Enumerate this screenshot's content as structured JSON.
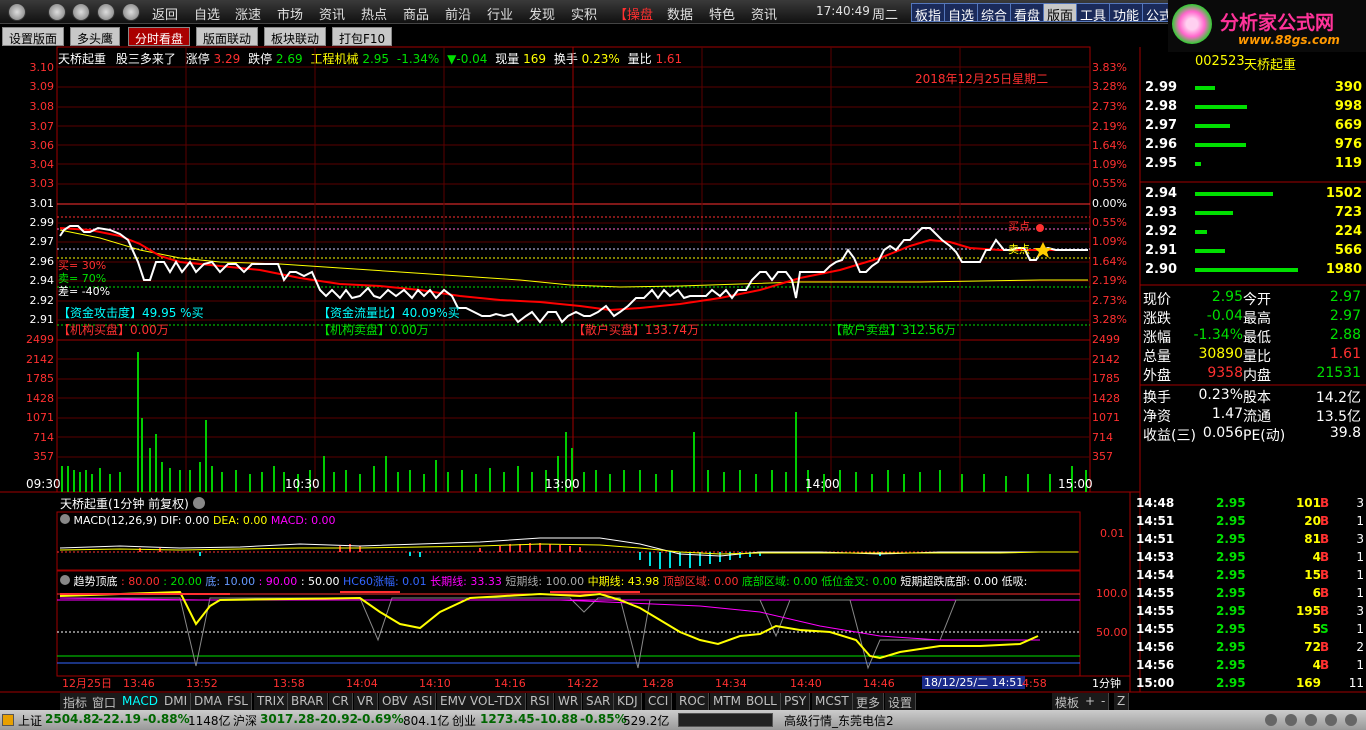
{
  "menu": {
    "items": [
      "返回",
      "自选",
      "涨速",
      "市场",
      "资讯",
      "热点",
      "商品",
      "前沿",
      "行业",
      "发现",
      "实积"
    ],
    "special": "【操盘",
    "items2": [
      "数据",
      "特色",
      "资讯"
    ],
    "time": "17:40:49",
    "weekday": "周二",
    "buttons": [
      "板指",
      "自选",
      "综合",
      "看盘",
      "版面",
      "工具",
      "功能",
      "公式"
    ]
  },
  "logo": {
    "line1": "分析家公式网",
    "line2": "www.88gs.com"
  },
  "tabs": [
    "设置版面",
    "多头鹰",
    "分时看盘",
    "版面联动",
    "板块联动",
    "打包F10"
  ],
  "header": {
    "name": "天桥起重",
    "tag": "股三多来了",
    "zt_label": "涨停",
    "zt": "3.29",
    "dt_label": "跌停",
    "dt": "2.69",
    "sector": "工程机械",
    "price": "2.95",
    "pct": "-1.34%",
    "chg": "▼-0.04",
    "xl_label": "现量",
    "xl": "169",
    "hs_label": "换手",
    "hs": "0.23%",
    "lb_label": "量比",
    "lb": "1.61",
    "date": "2018年12月25日星期二"
  },
  "price_axis": {
    "left": [
      "3.10",
      "3.09",
      "3.08",
      "3.07",
      "3.06",
      "3.04",
      "3.03",
      "3.01",
      "2.99",
      "2.97",
      "2.96",
      "2.94",
      "2.92",
      "2.91",
      "2.89"
    ],
    "right": [
      "3.83%",
      "3.28%",
      "2.73%",
      "2.19%",
      "1.64%",
      "1.09%",
      "0.55%",
      "0.00%",
      "0.55%",
      "1.09%",
      "1.64%",
      "2.19%",
      "2.73%",
      "3.28%"
    ]
  },
  "vol_axis": [
    "2499",
    "2142",
    "1785",
    "1428",
    "1071",
    "714",
    "357"
  ],
  "time_axis": [
    "09:30",
    "10:30",
    "13:00",
    "14:00",
    "15:00"
  ],
  "overlay": {
    "buy": "买= 30%",
    "sell": "卖= 70%",
    "diff": "差= -40%",
    "attack": "【资金攻击度】49.95 %买",
    "flow": "【资金流量比】40.09%买",
    "org_buy": "【机构买盘】0.00万",
    "org_sell": "【机构卖盘】0.00万",
    "retail_buy": "【散户买盘】133.74万",
    "retail_sell": "【散户卖盘】312.56万",
    "buy_pt": "买点",
    "sell_pt": "卖点"
  },
  "sub_title": "天桥起重(1分钟 前复权)",
  "macd": {
    "label": "MACD(12,26,9)",
    "dif": "DIF: 0.00",
    "dea": "DEA: 0.00",
    "macd": "MACD: 0.00",
    "axis": "0.01"
  },
  "trend": {
    "label": "趋势顶底",
    "v1": ": 80.00",
    "v2": ": 20.00",
    "v3": "底: 10.00",
    "v4": ": 90.00",
    "v5": ": 50.00",
    "hc": "HC60涨幅: 0.01",
    "lq": "长期线: 33.33",
    "sq": "短期线: 100.00",
    "mq": "中期线: 43.98",
    "top": "顶部区域: 0.00",
    "bot": "底部区域: 0.00",
    "gold": "低位金叉: 0.00",
    "over": "短期超跌底部: 0.00",
    "low": "低吸:",
    "axis": [
      "100.0",
      "50.00"
    ]
  },
  "sub_time": [
    "12月25日",
    "13:46",
    "13:52",
    "13:58",
    "14:04",
    "14:10",
    "14:16",
    "14:22",
    "14:28",
    "14:34",
    "14:40",
    "14:46",
    "14:52"
  ],
  "sub_cursor": "18/12/25/二 14:51",
  "sub_period": "1分钟",
  "sub_end": "4:58",
  "indicators": [
    "指标",
    "窗口",
    "MACD",
    "DMI",
    "DMA",
    "FSL",
    "TRIX",
    "BRAR",
    "CR",
    "VR",
    "OBV",
    "ASI",
    "EMV",
    "VOL-TDX",
    "RSI",
    "WR",
    "SAR",
    "KDJ",
    "CCI",
    "ROC",
    "MTM",
    "BOLL",
    "PSY",
    "MCST",
    "更多",
    "设置"
  ],
  "right_btns": [
    "模板",
    "+",
    "-",
    "Z"
  ],
  "stock": {
    "code": "002523",
    "name": "天桥起重"
  },
  "asks": [
    {
      "p": "2.99",
      "q": "390"
    },
    {
      "p": "2.98",
      "q": "998"
    },
    {
      "p": "2.97",
      "q": "669"
    },
    {
      "p": "2.96",
      "q": "976"
    },
    {
      "p": "2.95",
      "q": "119"
    }
  ],
  "bids": [
    {
      "p": "2.94",
      "q": "1502"
    },
    {
      "p": "2.93",
      "q": "723"
    },
    {
      "p": "2.92",
      "q": "224"
    },
    {
      "p": "2.91",
      "q": "566"
    },
    {
      "p": "2.90",
      "q": "1980"
    }
  ],
  "quote": [
    {
      "l1": "现价",
      "v1": "2.95",
      "l2": "今开",
      "v2": "2.97"
    },
    {
      "l1": "涨跌",
      "v1": "-0.04",
      "l2": "最高",
      "v2": "2.97"
    },
    {
      "l1": "涨幅",
      "v1": "-1.34%",
      "l2": "最低",
      "v2": "2.88"
    },
    {
      "l1": "总量",
      "v1": "30890",
      "l2": "量比",
      "v2": "1.61"
    },
    {
      "l1": "外盘",
      "v1": "9358",
      "l2": "内盘",
      "v2": "21531"
    },
    {
      "l1": "换手",
      "v1": "0.23%",
      "l2": "股本",
      "v2": "14.2亿"
    },
    {
      "l1": "净资",
      "v1": "1.47",
      "l2": "流通",
      "v2": "13.5亿"
    },
    {
      "l1": "收益(三)",
      "v1": "0.056",
      "l2": "PE(动)",
      "v2": "39.8"
    }
  ],
  "ticks": [
    {
      "t": "14:48",
      "p": "2.95",
      "v": "101",
      "d": "B",
      "n": "3"
    },
    {
      "t": "14:51",
      "p": "2.95",
      "v": "20",
      "d": "B",
      "n": "1"
    },
    {
      "t": "14:51",
      "p": "2.95",
      "v": "81",
      "d": "B",
      "n": "3"
    },
    {
      "t": "14:53",
      "p": "2.95",
      "v": "4",
      "d": "B",
      "n": "1"
    },
    {
      "t": "14:54",
      "p": "2.95",
      "v": "15",
      "d": "B",
      "n": "1"
    },
    {
      "t": "14:55",
      "p": "2.95",
      "v": "6",
      "d": "B",
      "n": "1"
    },
    {
      "t": "14:55",
      "p": "2.95",
      "v": "195",
      "d": "B",
      "n": "3"
    },
    {
      "t": "14:55",
      "p": "2.95",
      "v": "5",
      "d": "S",
      "n": "1"
    },
    {
      "t": "14:56",
      "p": "2.95",
      "v": "72",
      "d": "B",
      "n": "2"
    },
    {
      "t": "14:56",
      "p": "2.95",
      "v": "4",
      "d": "B",
      "n": "1"
    },
    {
      "t": "15:00",
      "p": "2.95",
      "v": "169",
      "d": "",
      "n": "11"
    }
  ],
  "status": {
    "sh_label": "上证",
    "sh": "2504.82",
    "sh_chg": "-22.19",
    "sh_pct": "-0.88%",
    "sh_amt": "1148亿",
    "sz_label": "沪深",
    "sz": "3017.28",
    "sz_chg": "-20.92",
    "sz_pct": "-0.69%",
    "sz_amt": "804.1亿",
    "cy_label": "创业",
    "cy": "1273.45",
    "cy_chg": "-10.88",
    "cy_pct": "-0.85%",
    "cy_amt": "529.2亿",
    "server": "高级行情_东莞电信2"
  }
}
